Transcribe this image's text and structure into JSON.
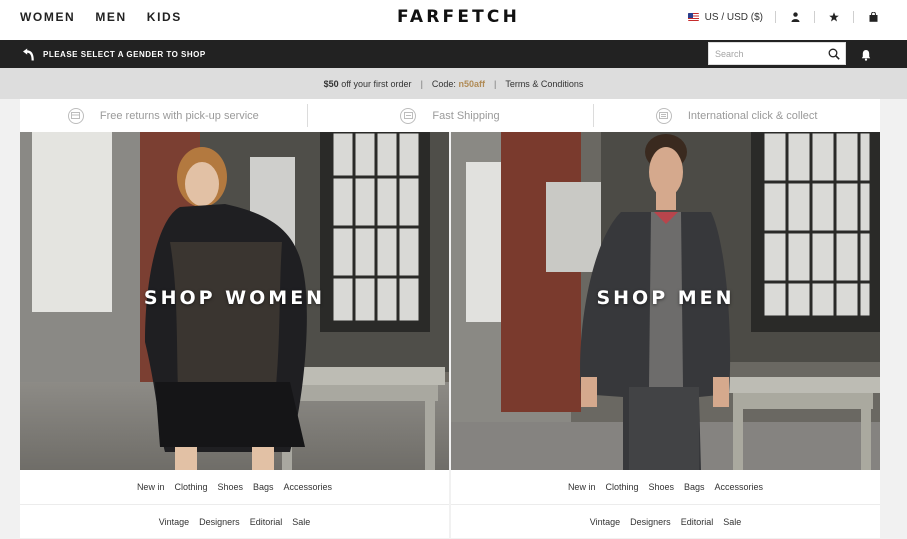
{
  "header": {
    "nav": [
      "WOMEN",
      "MEN",
      "KIDS"
    ],
    "logo": "FARFETCH",
    "locale": "US / USD ($)",
    "icons": [
      "us-flag-icon",
      "user-icon",
      "star-icon",
      "bag-icon"
    ]
  },
  "bar": {
    "message": "PLEASE SELECT A GENDER TO SHOP",
    "search_placeholder": "Search",
    "icons": [
      "arrow-icon",
      "search-icon",
      "bell-icon"
    ]
  },
  "promo": {
    "amount": "$50",
    "rest": "off your first order",
    "code_label": "Code:",
    "code": "n50aff",
    "terms": "Terms & Conditions"
  },
  "benefits": [
    {
      "icon": "returns-icon",
      "label": "Free returns with pick-up service"
    },
    {
      "icon": "shipping-icon",
      "label": "Fast Shipping"
    },
    {
      "icon": "collect-icon",
      "label": "International click & collect"
    }
  ],
  "women": {
    "title": "SHOP WOMEN",
    "links1": [
      "New in",
      "Clothing",
      "Shoes",
      "Bags",
      "Accessories"
    ],
    "links2": [
      "Vintage",
      "Designers",
      "Editorial",
      "Sale"
    ]
  },
  "men": {
    "title": "SHOP MEN",
    "links1": [
      "New in",
      "Clothing",
      "Shoes",
      "Bags",
      "Accessories"
    ],
    "links2": [
      "Vintage",
      "Designers",
      "Editorial",
      "Sale"
    ]
  },
  "colors": {
    "bar": "#222222",
    "promo_bg": "#dddddd",
    "code": "#b08b56"
  }
}
